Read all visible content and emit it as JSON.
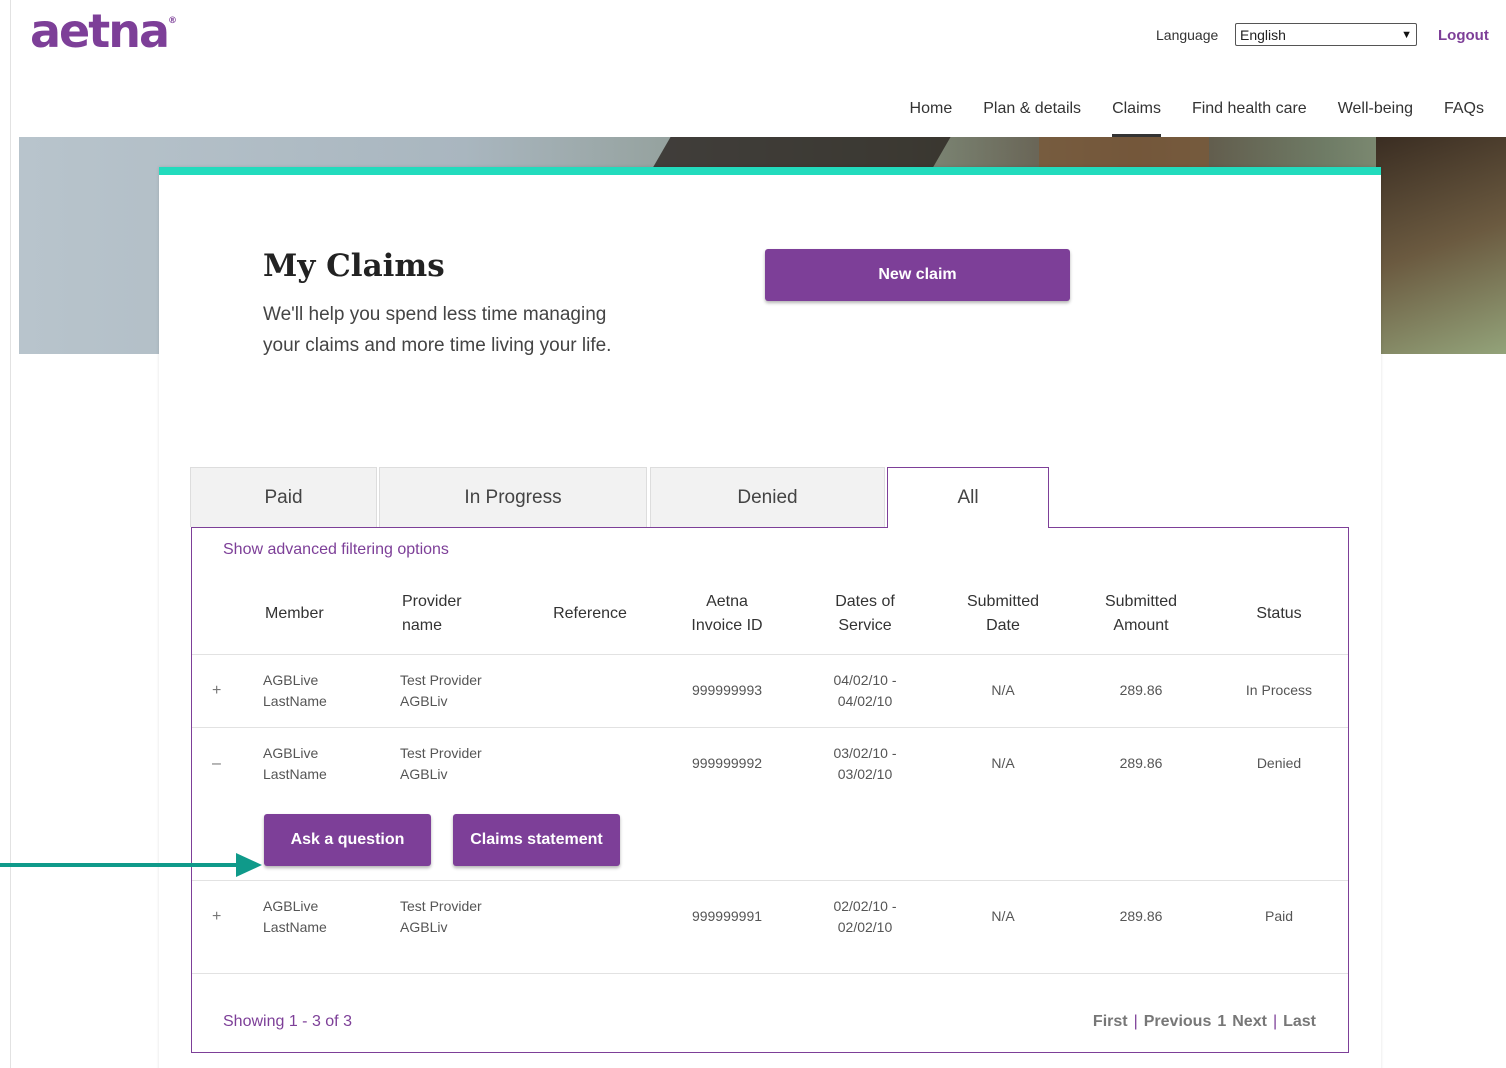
{
  "header": {
    "logo_text": "aetna",
    "logo_mark": "®",
    "language_label": "Language",
    "language_value": "English",
    "logout_label": "Logout"
  },
  "nav": [
    "Home",
    "Plan & details",
    "Claims",
    "Find health care",
    "Well-being",
    "FAQs"
  ],
  "main": {
    "title": "My Claims",
    "subtitle": "We'll help you spend less time managing your claims and more time living your life.",
    "new_claim_label": "New claim"
  },
  "tabs": [
    "Paid",
    "In Progress",
    "Denied",
    "All"
  ],
  "active_tab": "All",
  "filters": {
    "advanced_label": "Show advanced filtering options"
  },
  "table": {
    "headers": {
      "member": "Member",
      "provider": [
        "Provider",
        "name"
      ],
      "reference": "Reference",
      "invoice": [
        "Aetna",
        "Invoice ID"
      ],
      "dates": [
        "Dates of",
        "Service"
      ],
      "submitted_date": [
        "Submitted",
        "Date"
      ],
      "submitted_amount": [
        "Submitted",
        "Amount"
      ],
      "status": "Status"
    },
    "rows": [
      {
        "expander": "+",
        "member": [
          "AGBLive",
          "LastName"
        ],
        "provider": [
          "Test Provider",
          "AGBLiv"
        ],
        "reference": "",
        "invoice": "999999993",
        "dates": [
          "04/02/10 -",
          "04/02/10"
        ],
        "submitted_date": "N/A",
        "amount": "289.86",
        "status": "In Process"
      },
      {
        "expander": "–",
        "member": [
          "AGBLive",
          "LastName"
        ],
        "provider": [
          "Test Provider",
          "AGBLiv"
        ],
        "reference": "",
        "invoice": "999999992",
        "dates": [
          "03/02/10 -",
          "03/02/10"
        ],
        "submitted_date": "N/A",
        "amount": "289.86",
        "status": "Denied"
      },
      {
        "expander": "+",
        "member": [
          "AGBLive",
          "LastName"
        ],
        "provider": [
          "Test Provider",
          "AGBLiv"
        ],
        "reference": "",
        "invoice": "999999991",
        "dates": [
          "02/02/10 -",
          "02/02/10"
        ],
        "submitted_date": "N/A",
        "amount": "289.86",
        "status": "Paid"
      }
    ],
    "expanded_actions": {
      "ask_label": "Ask a question",
      "statement_label": "Claims statement"
    }
  },
  "footer": {
    "showing": "Showing 1 - 3 of 3",
    "pager": {
      "first": "First",
      "separator": "|",
      "previous": "Previous",
      "page": "1",
      "next": "Next",
      "last": "Last"
    }
  },
  "colors": {
    "brand_purple": "#7d3f98",
    "accent_teal": "#22dbbd",
    "arrow_teal": "#0f9a8a"
  },
  "icons": [
    "chevron-down-icon",
    "expand-plus-icon",
    "collapse-minus-icon",
    "arrow-right-icon"
  ]
}
